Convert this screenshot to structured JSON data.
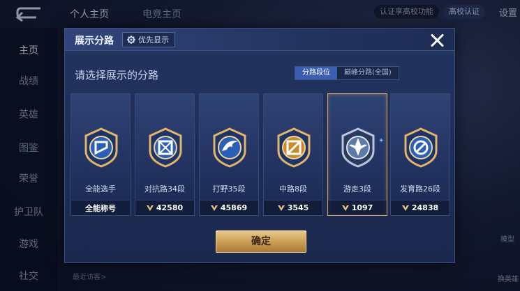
{
  "background": {
    "top_tabs": [
      {
        "label": "个人主页",
        "active": true
      },
      {
        "label": "电竞主页",
        "active": false
      }
    ],
    "nav_items": [
      {
        "label": "主页",
        "active": true
      },
      {
        "label": "战绩",
        "active": false
      },
      {
        "label": "英雄",
        "active": false
      },
      {
        "label": "图鉴",
        "active": false
      },
      {
        "label": "荣誉",
        "active": false
      },
      {
        "label": "护卫队",
        "active": false
      },
      {
        "label": "游戏",
        "active": false
      },
      {
        "label": "社交",
        "active": false
      }
    ],
    "top_right": {
      "verify_text": "认证享高校功能",
      "school_badge": "高校认证",
      "settings_label": "设置"
    },
    "bottom_hint": "最近访客>",
    "right_labels": [
      "模型",
      "换英雄"
    ]
  },
  "dialog": {
    "title": "展示分路",
    "priority_label": "优先显示",
    "prompt": "请选择展示的分路",
    "tabs": [
      {
        "label": "分路段位",
        "active": true
      },
      {
        "label": "巅峰分路(全国)",
        "active": false
      }
    ],
    "cards": [
      {
        "name": "全能选手",
        "value": "全能称号",
        "show_icon": false,
        "emblem": "all-round-emblem-icon",
        "selected": false
      },
      {
        "name": "对抗路34段",
        "value": "42580",
        "show_icon": true,
        "emblem": "clash-lane-emblem-icon",
        "selected": false
      },
      {
        "name": "打野35段",
        "value": "45869",
        "show_icon": true,
        "emblem": "jungle-emblem-icon",
        "selected": false
      },
      {
        "name": "中路8段",
        "value": "3545",
        "show_icon": true,
        "emblem": "mid-lane-emblem-icon",
        "selected": false
      },
      {
        "name": "游走3段",
        "value": "1097",
        "show_icon": true,
        "emblem": "roam-emblem-icon",
        "selected": true
      },
      {
        "name": "发育路26段",
        "value": "24838",
        "show_icon": true,
        "emblem": "farm-lane-emblem-icon",
        "selected": false
      }
    ],
    "confirm_label": "确定"
  },
  "colors": {
    "accent_gold": "#d9a866",
    "tab_active": "#3b5fb0",
    "panel": "#233460"
  }
}
